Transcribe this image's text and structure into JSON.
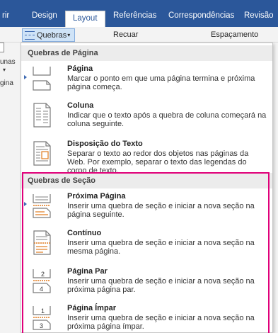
{
  "tabs": [
    {
      "label": "rir",
      "active": false
    },
    {
      "label": "Design",
      "active": false
    },
    {
      "label": "Layout",
      "active": true
    },
    {
      "label": "Referências",
      "active": false
    },
    {
      "label": "Correspondências",
      "active": false
    },
    {
      "label": "Revisão",
      "active": false
    }
  ],
  "ribbon": {
    "quebras_label": "Quebras",
    "quebras_arrow": "▾",
    "recuar_label": "Recuar",
    "espacamento_label": "Espaçamento"
  },
  "side": {
    "frag1": "unas",
    "frag2": "gina"
  },
  "menu": {
    "page_breaks_header": "Quebras de Página",
    "section_breaks_header": "Quebras de Seção",
    "items": [
      {
        "title": "Página",
        "desc": "Marcar o ponto em que uma página termina e próxima página começa.",
        "icon": "page-break-icon"
      },
      {
        "title": "Coluna",
        "desc": "Indicar que o texto após a quebra de coluna começará na coluna seguinte.",
        "icon": "column-break-icon"
      },
      {
        "title": "Disposição do Texto",
        "desc": "Separar o texto ao redor dos objetos nas páginas da Web. Por exemplo, separar o texto das legendas do corpo de texto.",
        "icon": "text-wrapping-icon"
      },
      {
        "title": "Próxima Página",
        "desc": "Inserir uma quebra de seção e iniciar a nova seção na página seguinte.",
        "icon": "next-page-icon"
      },
      {
        "title": "Contínuo",
        "desc": "Inserir uma quebra de seção e iniciar a nova seção na mesma página.",
        "icon": "continuous-icon"
      },
      {
        "title": "Página Par",
        "desc": "Inserir uma quebra de seção e iniciar a nova seção na próxima página par.",
        "icon": "even-page-icon"
      },
      {
        "title": "Página Ímpar",
        "desc": "Inserir uma quebra de seção e iniciar a nova seção na próxima página ímpar.",
        "icon": "odd-page-icon"
      }
    ],
    "even_icon_number": "2",
    "even_icon_number2": "4",
    "odd_icon_number": "1",
    "odd_icon_number2": "3"
  },
  "colors": {
    "ribbon_blue": "#2b579a",
    "highlight_frame": "#e0007a",
    "button_selected": "#cfe3f7"
  }
}
